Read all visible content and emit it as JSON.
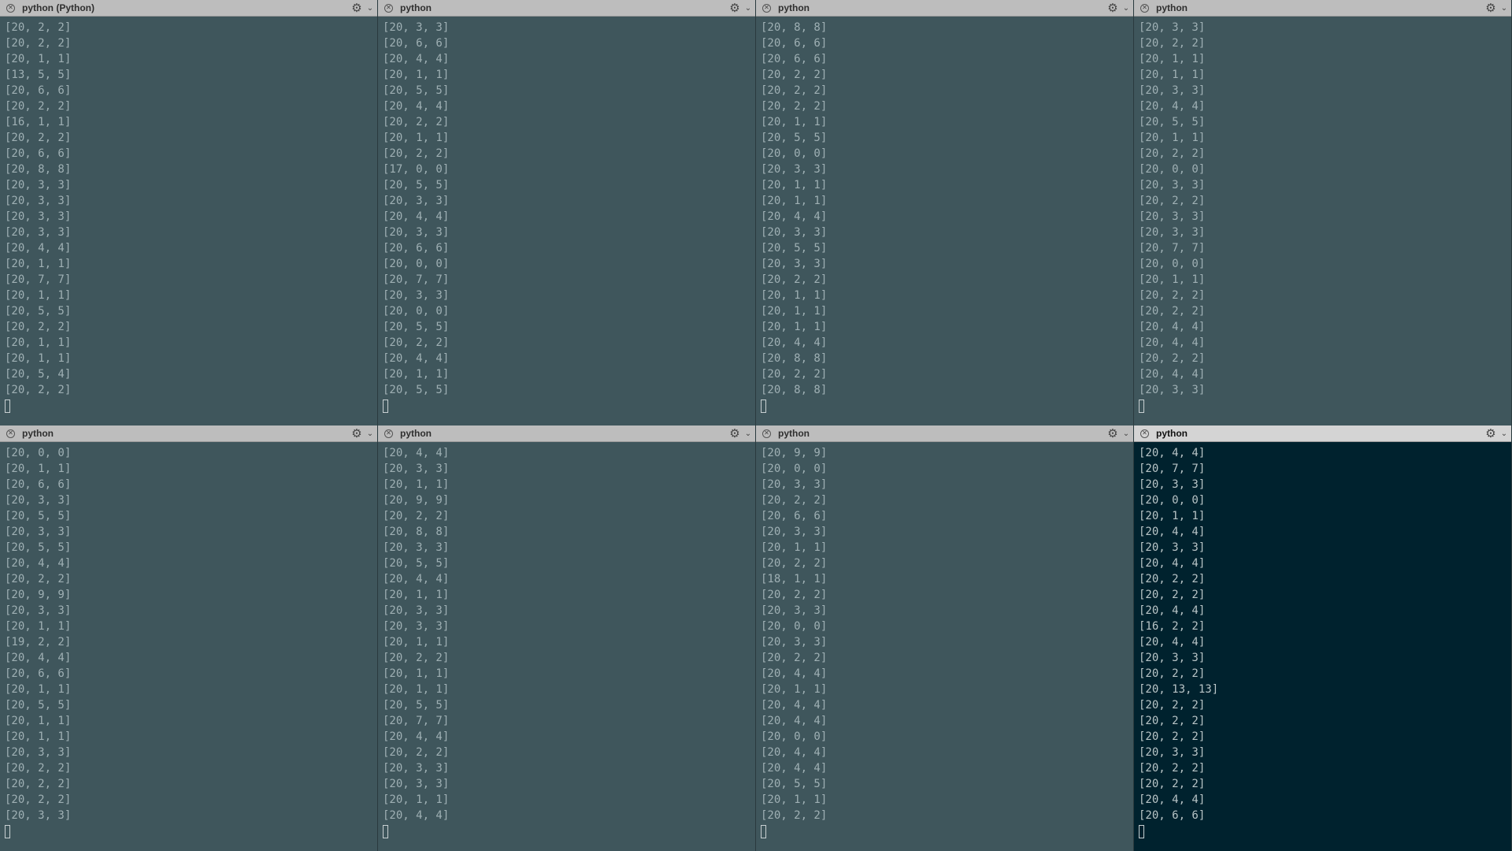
{
  "panes": [
    {
      "title": "python (Python)",
      "active": false,
      "lines": [
        "[20, 2, 2]",
        "[20, 2, 2]",
        "[20, 1, 1]",
        "[13, 5, 5]",
        "[20, 6, 6]",
        "[20, 2, 2]",
        "[16, 1, 1]",
        "[20, 2, 2]",
        "[20, 6, 6]",
        "[20, 8, 8]",
        "[20, 3, 3]",
        "[20, 3, 3]",
        "[20, 3, 3]",
        "[20, 3, 3]",
        "[20, 4, 4]",
        "[20, 1, 1]",
        "[20, 7, 7]",
        "[20, 1, 1]",
        "[20, 5, 5]",
        "[20, 2, 2]",
        "[20, 1, 1]",
        "[20, 1, 1]",
        "[20, 5, 4]",
        "[20, 2, 2]"
      ]
    },
    {
      "title": "python",
      "active": false,
      "lines": [
        "[20, 3, 3]",
        "[20, 6, 6]",
        "[20, 4, 4]",
        "[20, 1, 1]",
        "[20, 5, 5]",
        "[20, 4, 4]",
        "[20, 2, 2]",
        "[20, 1, 1]",
        "[20, 2, 2]",
        "[17, 0, 0]",
        "[20, 5, 5]",
        "[20, 3, 3]",
        "[20, 4, 4]",
        "[20, 3, 3]",
        "[20, 6, 6]",
        "[20, 0, 0]",
        "[20, 7, 7]",
        "[20, 3, 3]",
        "[20, 0, 0]",
        "[20, 5, 5]",
        "[20, 2, 2]",
        "[20, 4, 4]",
        "[20, 1, 1]",
        "[20, 5, 5]"
      ]
    },
    {
      "title": "python",
      "active": false,
      "lines": [
        "[20, 8, 8]",
        "[20, 6, 6]",
        "[20, 6, 6]",
        "[20, 2, 2]",
        "[20, 2, 2]",
        "[20, 2, 2]",
        "[20, 1, 1]",
        "[20, 5, 5]",
        "[20, 0, 0]",
        "[20, 3, 3]",
        "[20, 1, 1]",
        "[20, 1, 1]",
        "[20, 4, 4]",
        "[20, 3, 3]",
        "[20, 5, 5]",
        "[20, 3, 3]",
        "[20, 2, 2]",
        "[20, 1, 1]",
        "[20, 1, 1]",
        "[20, 1, 1]",
        "[20, 4, 4]",
        "[20, 8, 8]",
        "[20, 2, 2]",
        "[20, 8, 8]"
      ]
    },
    {
      "title": "python",
      "active": false,
      "lines": [
        "[20, 3, 3]",
        "[20, 2, 2]",
        "[20, 1, 1]",
        "[20, 1, 1]",
        "[20, 3, 3]",
        "[20, 4, 4]",
        "[20, 5, 5]",
        "[20, 1, 1]",
        "[20, 2, 2]",
        "[20, 0, 0]",
        "[20, 3, 3]",
        "[20, 2, 2]",
        "[20, 3, 3]",
        "[20, 3, 3]",
        "[20, 7, 7]",
        "[20, 0, 0]",
        "[20, 1, 1]",
        "[20, 2, 2]",
        "[20, 2, 2]",
        "[20, 4, 4]",
        "[20, 4, 4]",
        "[20, 2, 2]",
        "[20, 4, 4]",
        "[20, 3, 3]"
      ]
    },
    {
      "title": "python",
      "active": false,
      "lines": [
        "[20, 0, 0]",
        "[20, 1, 1]",
        "[20, 6, 6]",
        "[20, 3, 3]",
        "[20, 5, 5]",
        "[20, 3, 3]",
        "[20, 5, 5]",
        "[20, 4, 4]",
        "[20, 2, 2]",
        "[20, 9, 9]",
        "[20, 3, 3]",
        "[20, 1, 1]",
        "[19, 2, 2]",
        "[20, 4, 4]",
        "[20, 6, 6]",
        "[20, 1, 1]",
        "[20, 5, 5]",
        "[20, 1, 1]",
        "[20, 1, 1]",
        "[20, 3, 3]",
        "[20, 2, 2]",
        "[20, 2, 2]",
        "[20, 2, 2]",
        "[20, 3, 3]"
      ]
    },
    {
      "title": "python",
      "active": false,
      "lines": [
        "[20, 4, 4]",
        "[20, 3, 3]",
        "[20, 1, 1]",
        "[20, 9, 9]",
        "[20, 2, 2]",
        "[20, 8, 8]",
        "[20, 3, 3]",
        "[20, 5, 5]",
        "[20, 4, 4]",
        "[20, 1, 1]",
        "[20, 3, 3]",
        "[20, 3, 3]",
        "[20, 1, 1]",
        "[20, 2, 2]",
        "[20, 1, 1]",
        "[20, 1, 1]",
        "[20, 5, 5]",
        "[20, 7, 7]",
        "[20, 4, 4]",
        "[20, 2, 2]",
        "[20, 3, 3]",
        "[20, 3, 3]",
        "[20, 1, 1]",
        "[20, 4, 4]"
      ]
    },
    {
      "title": "python",
      "active": false,
      "lines": [
        "[20, 9, 9]",
        "[20, 0, 0]",
        "[20, 3, 3]",
        "[20, 2, 2]",
        "[20, 6, 6]",
        "[20, 3, 3]",
        "[20, 1, 1]",
        "[20, 2, 2]",
        "[18, 1, 1]",
        "[20, 2, 2]",
        "[20, 3, 3]",
        "[20, 0, 0]",
        "[20, 3, 3]",
        "[20, 2, 2]",
        "[20, 4, 4]",
        "[20, 1, 1]",
        "[20, 4, 4]",
        "[20, 4, 4]",
        "[20, 0, 0]",
        "[20, 4, 4]",
        "[20, 4, 4]",
        "[20, 5, 5]",
        "[20, 1, 1]",
        "[20, 2, 2]"
      ]
    },
    {
      "title": "python",
      "active": true,
      "lines": [
        "[20, 4, 4]",
        "[20, 7, 7]",
        "[20, 3, 3]",
        "[20, 0, 0]",
        "[20, 1, 1]",
        "[20, 4, 4]",
        "[20, 3, 3]",
        "[20, 4, 4]",
        "[20, 2, 2]",
        "[20, 2, 2]",
        "[20, 4, 4]",
        "[16, 2, 2]",
        "[20, 4, 4]",
        "[20, 3, 3]",
        "[20, 2, 2]",
        "[20, 13, 13]",
        "[20, 2, 2]",
        "[20, 2, 2]",
        "[20, 2, 2]",
        "[20, 3, 3]",
        "[20, 2, 2]",
        "[20, 2, 2]",
        "[20, 4, 4]",
        "[20, 6, 6]"
      ]
    }
  ],
  "icons": {
    "close": "close-icon",
    "settings": "gear-icon",
    "menu": "chevron-down-icon",
    "cursor": "block-cursor-icon"
  },
  "colors": {
    "pane_bg": "#3f565c",
    "active_pane_bg": "#00222e",
    "titlebar_bg": "#bdbdbd",
    "text": "#9fb0b4"
  }
}
